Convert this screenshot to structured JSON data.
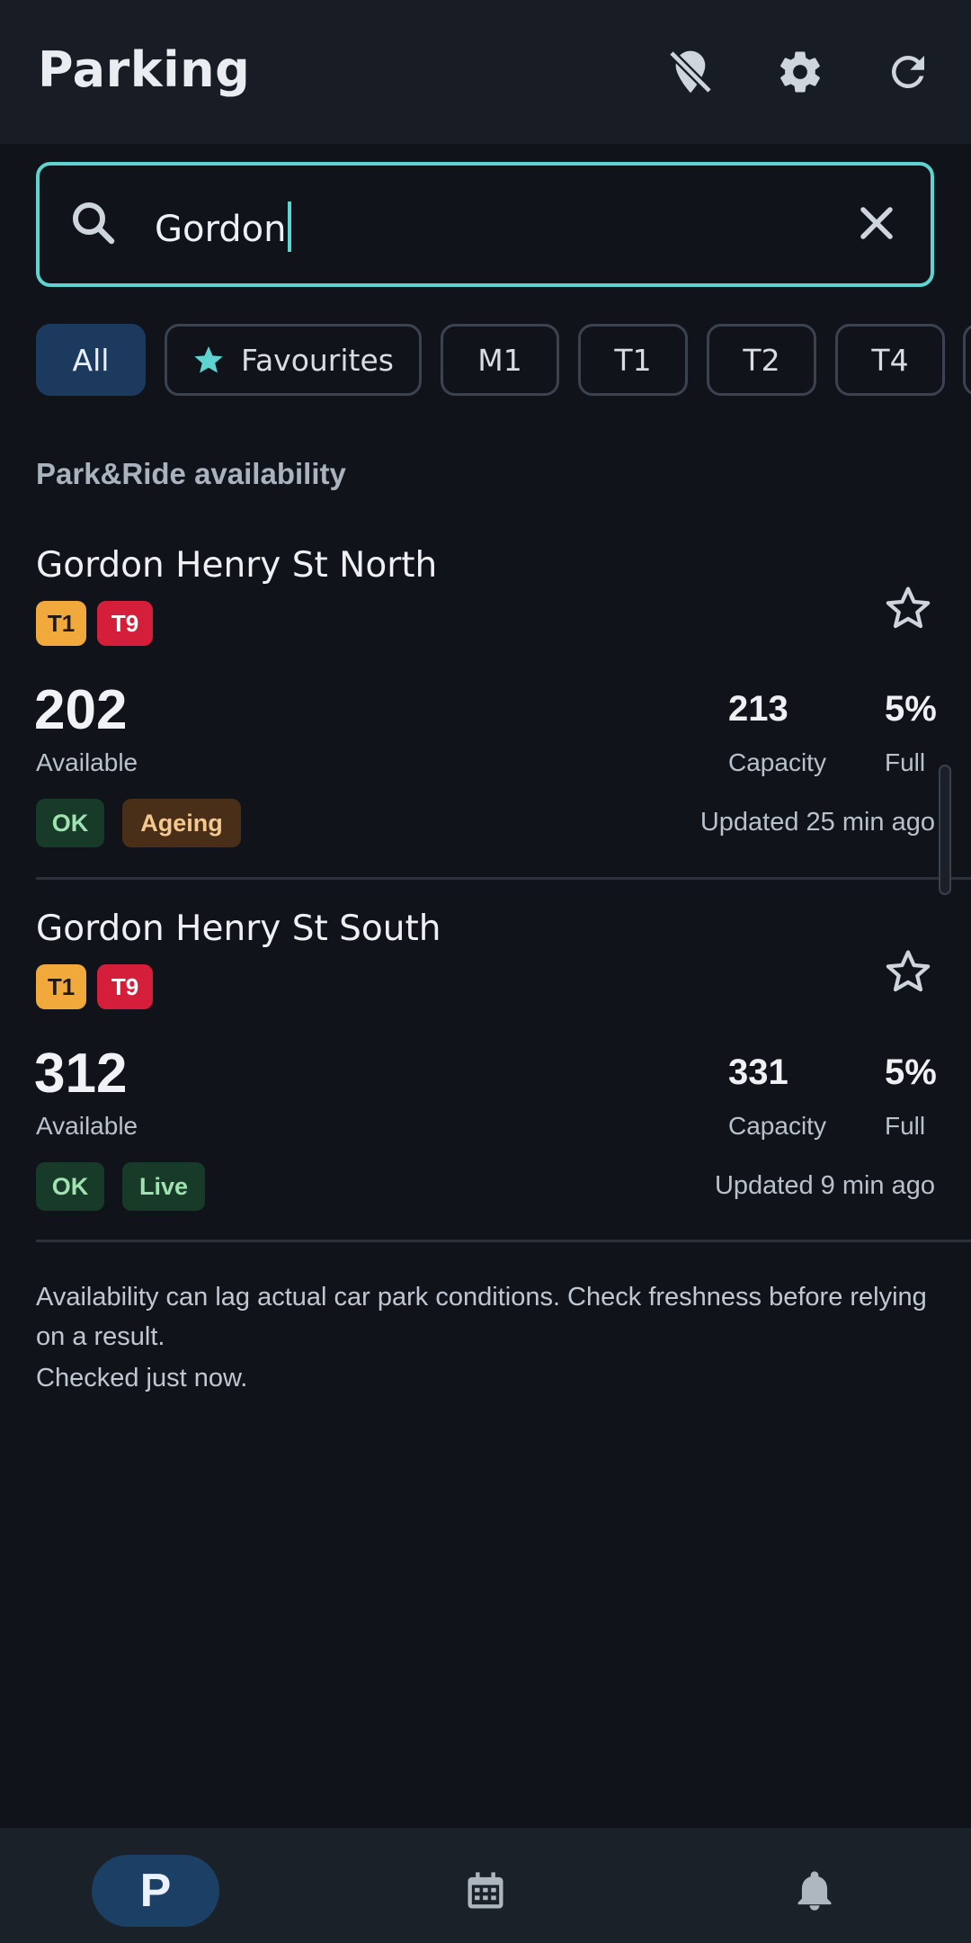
{
  "appbar": {
    "title": "Parking",
    "actions": [
      {
        "icon": "location-off-icon"
      },
      {
        "icon": "gear-icon"
      },
      {
        "icon": "refresh-icon"
      }
    ]
  },
  "search": {
    "value": "Gordon",
    "icon": "search-icon",
    "clear_icon": "close-icon"
  },
  "filters": [
    {
      "label": "All",
      "active": true
    },
    {
      "label": "Favourites",
      "icon": "star-icon"
    },
    {
      "label": "M1"
    },
    {
      "label": "T1"
    },
    {
      "label": "T2"
    },
    {
      "label": "T4"
    }
  ],
  "section_title": "Park&Ride availability",
  "carparks": [
    {
      "name": "Gordon Henry St North",
      "lines": [
        "T1",
        "T9"
      ],
      "available": "202",
      "available_label": "Available",
      "capacity": "213",
      "capacity_label": "Capacity",
      "full": "5%",
      "full_label": "Full",
      "statuses": [
        "OK",
        "Ageing"
      ],
      "updated": "Updated 25 min ago"
    },
    {
      "name": "Gordon Henry St South",
      "lines": [
        "T1",
        "T9"
      ],
      "available": "312",
      "available_label": "Available",
      "capacity": "331",
      "capacity_label": "Capacity",
      "full": "5%",
      "full_label": "Full",
      "statuses": [
        "OK",
        "Live"
      ],
      "updated": "Updated 9 min ago"
    }
  ],
  "disclaimer": {
    "text": "Availability can lag actual car park conditions. Check freshness before relying on a result.",
    "checked": "Checked just now."
  },
  "bottom_nav": {
    "parking_letter": "P",
    "items": [
      {
        "icon": "parking-icon",
        "active": true
      },
      {
        "icon": "calendar-icon"
      },
      {
        "icon": "bell-icon"
      }
    ]
  },
  "colors": {
    "accent": "#5fd3cf",
    "active_chip": "#1b3a5e",
    "line_t1": "#f2a93b",
    "line_t9": "#d51f3a",
    "ok": "#183a28",
    "ageing": "#4a2f18"
  }
}
